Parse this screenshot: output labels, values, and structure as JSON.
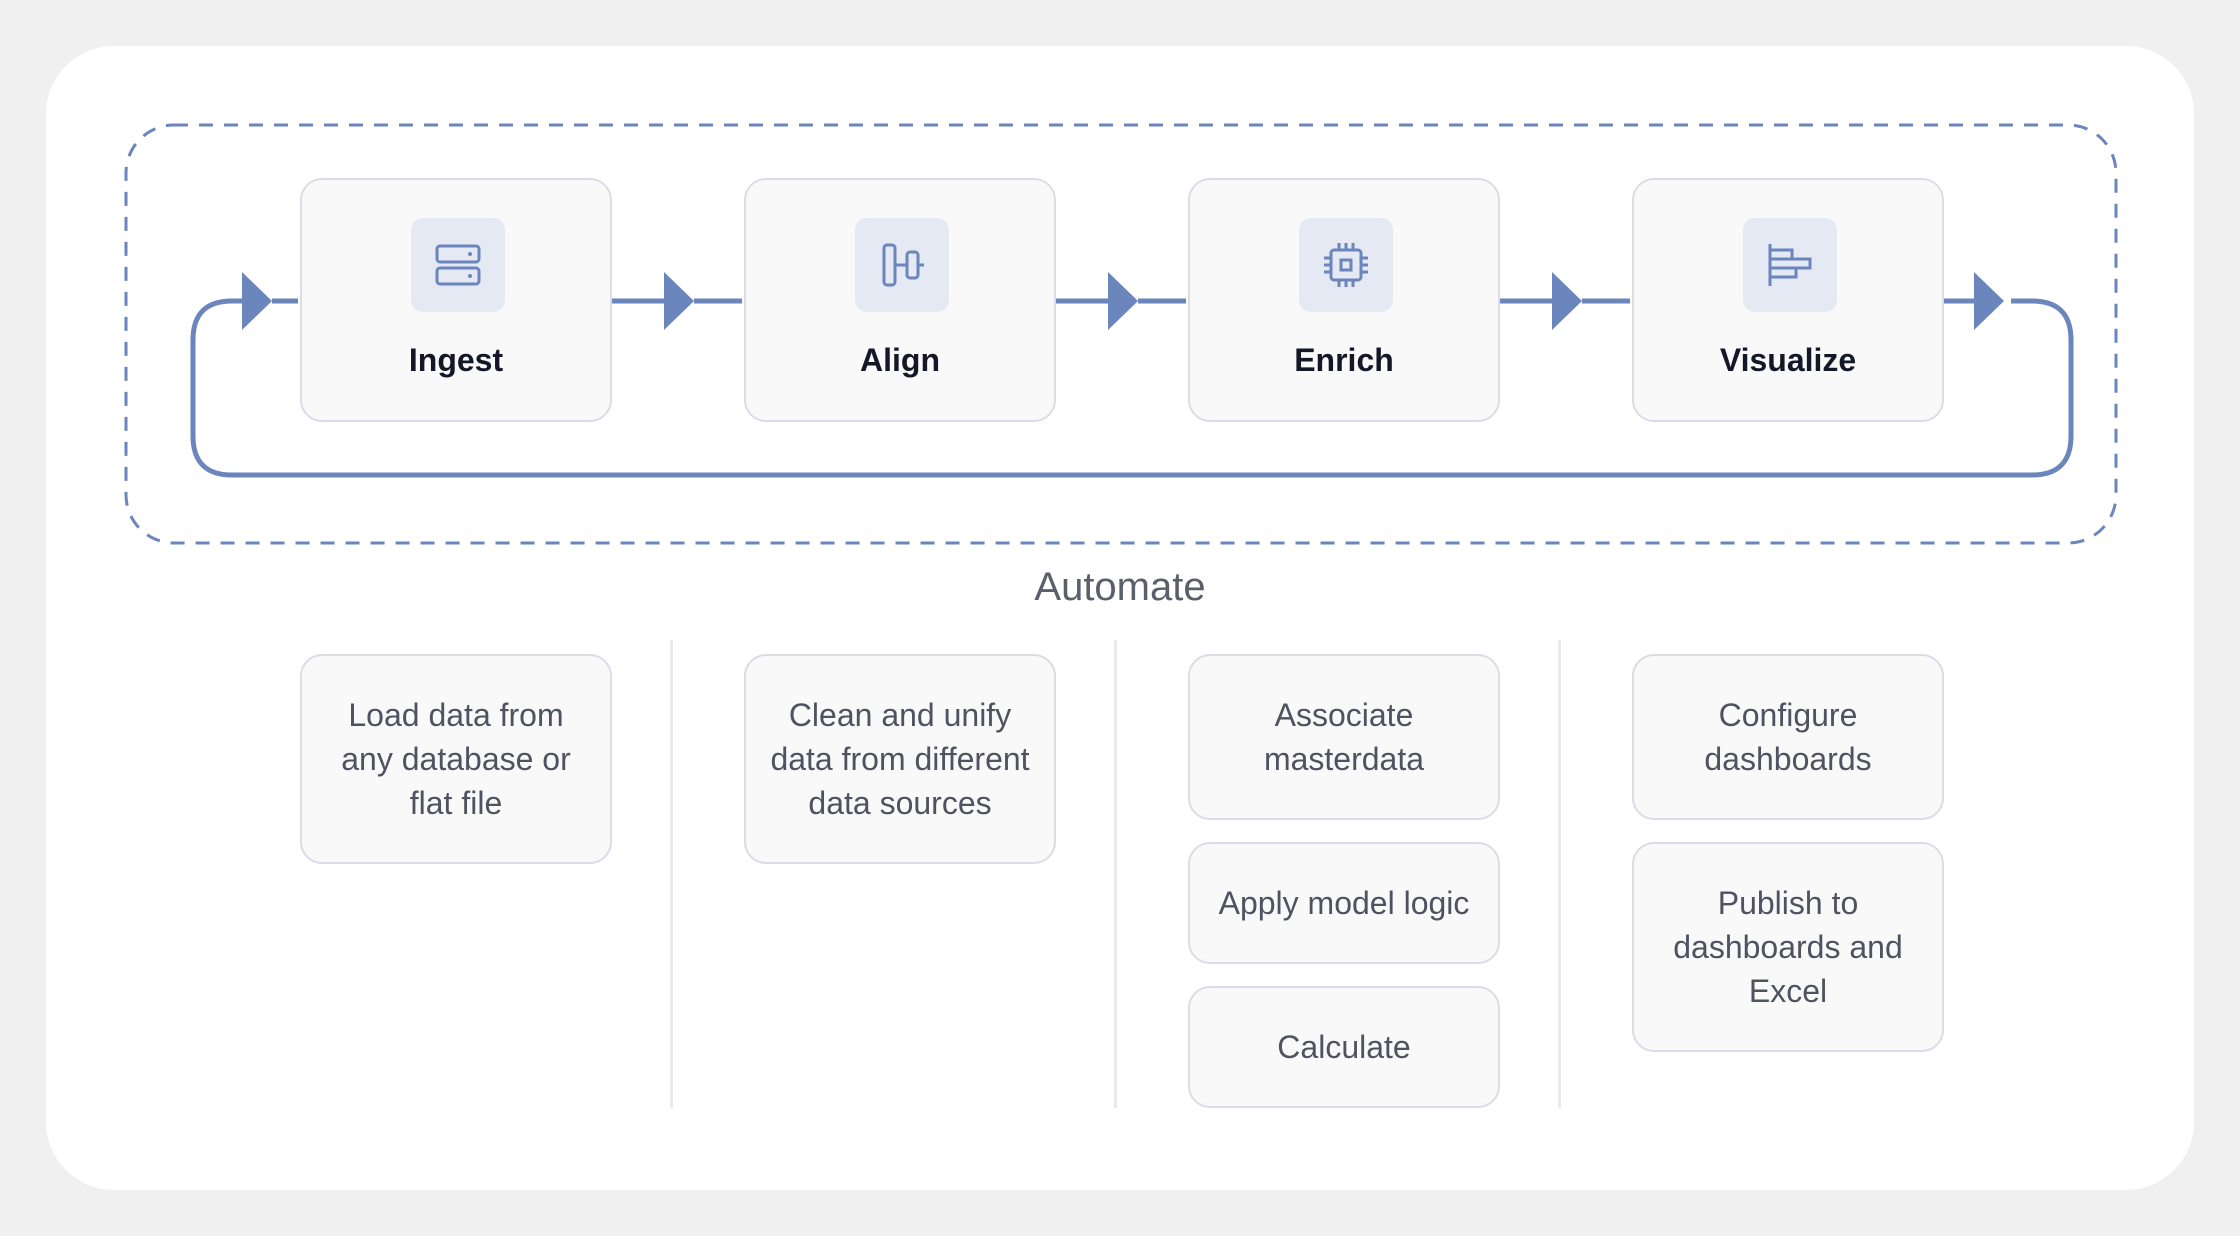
{
  "loop_label": "Automate",
  "stages": [
    {
      "label": "Ingest",
      "icon": "server-icon"
    },
    {
      "label": "Align",
      "icon": "align-center-icon"
    },
    {
      "label": "Enrich",
      "icon": "cpu-chip-icon"
    },
    {
      "label": "Visualize",
      "icon": "bar-chart-horizontal-icon"
    }
  ],
  "tasks": {
    "ingest": [
      "Load data from any database or flat file"
    ],
    "align": [
      "Clean and unify data from different data sources"
    ],
    "enrich": [
      "Associate masterdata",
      "Apply model logic",
      "Calculate"
    ],
    "visualize": [
      "Configure dashboards",
      "Publish to dashboards and Excel"
    ]
  },
  "colors": {
    "background": "#f0f0f0",
    "card": "#ffffff",
    "accent": "#6b85bd",
    "icon_bg": "#e4e9f3",
    "box_border": "#dcdbe8",
    "box_fill": "#f9f9fa",
    "text_dark": "#141826",
    "text_muted": "#4f5360"
  }
}
